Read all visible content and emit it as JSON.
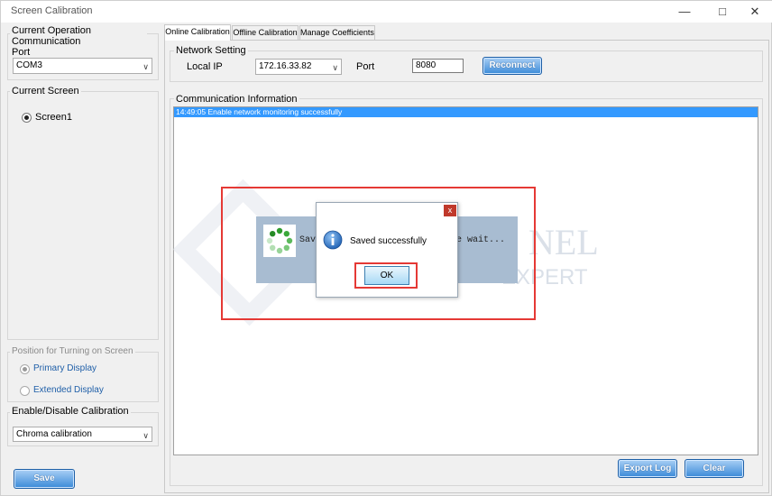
{
  "window": {
    "title": "Screen Calibration"
  },
  "titlebar_icons": [
    "minimize-icon",
    "maximize-icon",
    "close-icon"
  ],
  "left_panel": {
    "port_group_label": "Current Operation Communication\nPort",
    "port_value": "COM3",
    "screen_group_label": "Current Screen",
    "screen_option": "Screen1",
    "position_group_label": "Position for Turning on Screen",
    "primary_display": "Primary Display",
    "extended_display": "Extended Display",
    "calibration_group_label": "Enable/Disable Calibration",
    "calibration_value": "Chroma calibration",
    "save_label": "Save"
  },
  "tabs": [
    {
      "label": "Online Calibration",
      "active": true
    },
    {
      "label": "Offline Calibration",
      "active": false
    },
    {
      "label": "Manage Coefficients",
      "active": false
    }
  ],
  "network": {
    "group_label": "Network Setting",
    "local_ip_label": "Local IP",
    "local_ip_value": "172.16.33.82",
    "port_label": "Port",
    "port_value": "8080",
    "reconnect_label": "Reconnect"
  },
  "communication": {
    "group_label": "Communication Information",
    "log_entries": [
      "14:49:05  Enable network monitoring successfully"
    ]
  },
  "progress_dialog": {
    "text_left": "Savi",
    "text_right": "e wait..."
  },
  "message_box": {
    "message": "Saved successfully",
    "ok_label": "OK",
    "close_label": "x"
  },
  "watermark": {
    "line1": "NEL",
    "line2": "EXPERT"
  },
  "bottom_buttons": {
    "export_log": "Export Log",
    "clear": "Clear"
  },
  "colors": {
    "accent": "#3a8ad8",
    "highlight": "#3399ff",
    "annotation": "#e53935",
    "dialog_close": "#c0392b"
  }
}
